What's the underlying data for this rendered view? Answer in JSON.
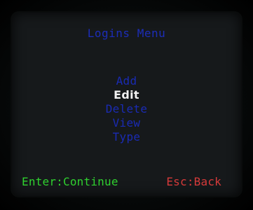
{
  "screen": {
    "title": "Logins Menu",
    "menu_items": [
      {
        "label": "Add"
      },
      {
        "label": "Edit"
      },
      {
        "label": "Delete"
      },
      {
        "label": "View"
      },
      {
        "label": "Type"
      }
    ],
    "selected_index": 1
  },
  "footer": {
    "enter_hint": "Enter:Continue",
    "esc_hint": "Esc:Back"
  },
  "colors": {
    "title": "#1c2db8",
    "menu_item": "#1a2bb4",
    "selected_item": "#f2f2f2",
    "enter_hint": "#2fd12f",
    "esc_hint": "#d63a3a",
    "background": "#16191b"
  }
}
